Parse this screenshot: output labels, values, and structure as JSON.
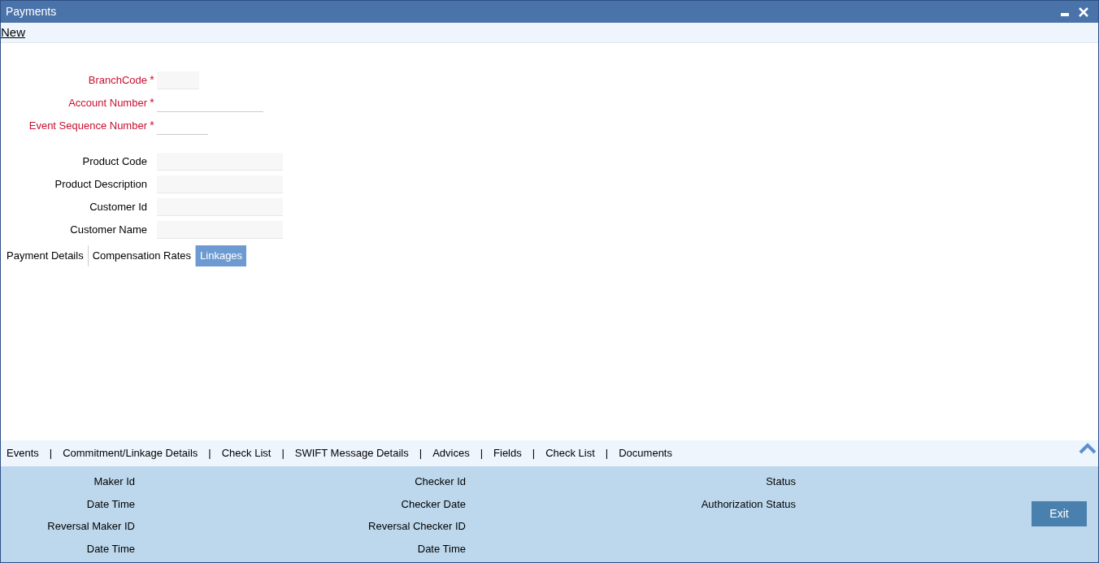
{
  "window": {
    "title": "Payments"
  },
  "toolbar": {
    "link": "New"
  },
  "fields": [
    {
      "label": "BranchCode",
      "required": true,
      "marker": "*",
      "kind": "box"
    },
    {
      "label": "Account Number",
      "required": true,
      "marker": "*",
      "kind": "line"
    },
    {
      "label": "Event Sequence Number",
      "required": true,
      "marker": "*",
      "kind": "line"
    },
    {
      "label": "Product Code",
      "required": false,
      "kind": "box"
    },
    {
      "label": "Product Description",
      "required": false,
      "kind": "box"
    },
    {
      "label": "Customer Id",
      "required": false,
      "kind": "box"
    },
    {
      "label": "Customer Name",
      "required": false,
      "kind": "box"
    }
  ],
  "tabs": [
    {
      "label": "Payment Details",
      "selected": false
    },
    {
      "label": "Compensation Rates",
      "selected": false
    },
    {
      "label": "Linkages",
      "selected": true
    }
  ],
  "footer_links": [
    {
      "kind": "link",
      "label": "Events"
    },
    {
      "kind": "separator",
      "label": "|"
    },
    {
      "kind": "link",
      "label": "Commitment/Linkage Details"
    },
    {
      "kind": "separator",
      "label": "|"
    },
    {
      "kind": "link",
      "label": "Check List"
    },
    {
      "kind": "separator",
      "label": "|"
    },
    {
      "kind": "link",
      "label": "SWIFT Message Details"
    },
    {
      "kind": "separator",
      "label": "|"
    },
    {
      "kind": "link",
      "label": "Advices"
    },
    {
      "kind": "separator",
      "label": "|"
    },
    {
      "kind": "link",
      "label": "Fields"
    },
    {
      "kind": "separator",
      "label": "|"
    },
    {
      "kind": "link",
      "label": "Check List"
    },
    {
      "kind": "separator",
      "label": "|"
    },
    {
      "kind": "link",
      "label": "Documents"
    }
  ],
  "audit": [
    [
      "Maker Id",
      "Date Time",
      "Reversal Maker ID",
      "Date Time"
    ],
    [
      "Checker Id",
      "Checker Date",
      "Reversal Checker ID",
      "Date Time"
    ],
    [
      "Status",
      "Authorization Status"
    ]
  ],
  "buttons": [
    "Exit"
  ]
}
